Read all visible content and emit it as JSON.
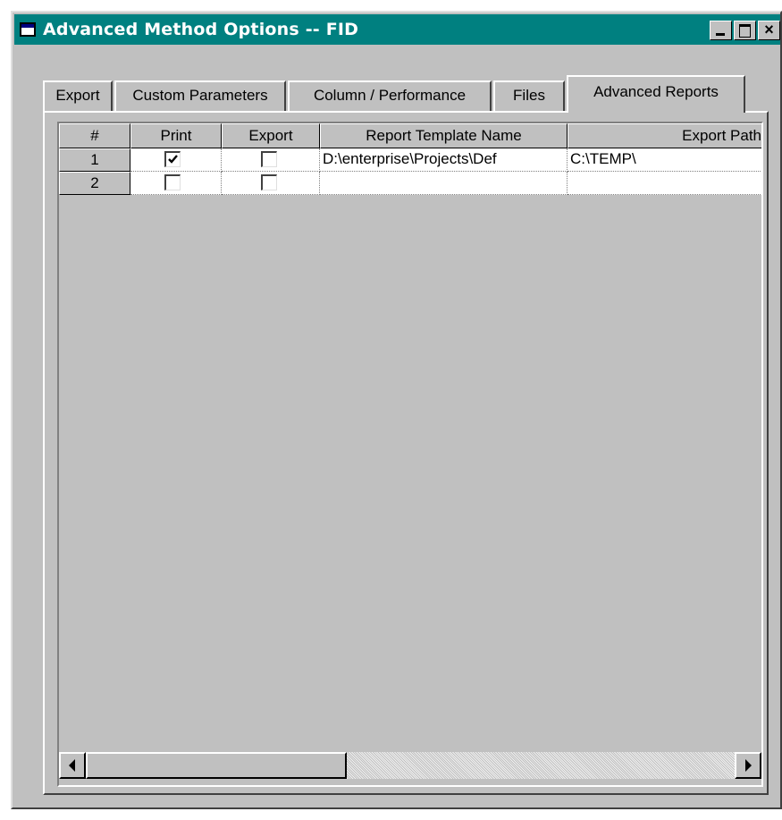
{
  "window": {
    "title": "Advanced Method Options -- FID",
    "app_icon": "window-icon",
    "caption_buttons": {
      "minimize": "minimize-icon",
      "maximize": "maximize-icon",
      "close": "×"
    }
  },
  "tabs": [
    {
      "label": "Export",
      "active": false
    },
    {
      "label": "Custom Parameters",
      "active": false
    },
    {
      "label": "Column / Performance",
      "active": false
    },
    {
      "label": "Files",
      "active": false
    },
    {
      "label": "Advanced Reports",
      "active": true
    }
  ],
  "grid": {
    "columns": [
      "#",
      "Print",
      "Export",
      "Report Template Name",
      "Export Path"
    ],
    "rows": [
      {
        "num": "1",
        "print": true,
        "export": false,
        "template": "D:\\enterprise\\Projects\\Def",
        "path": "C:\\TEMP\\"
      },
      {
        "num": "2",
        "print": false,
        "export": false,
        "template": "",
        "path": ""
      }
    ]
  },
  "scrollbar": {
    "left_icon": "arrow-left-icon",
    "right_icon": "arrow-right-icon"
  },
  "colors": {
    "titlebar": "#008080",
    "face": "#c0c0c0"
  }
}
